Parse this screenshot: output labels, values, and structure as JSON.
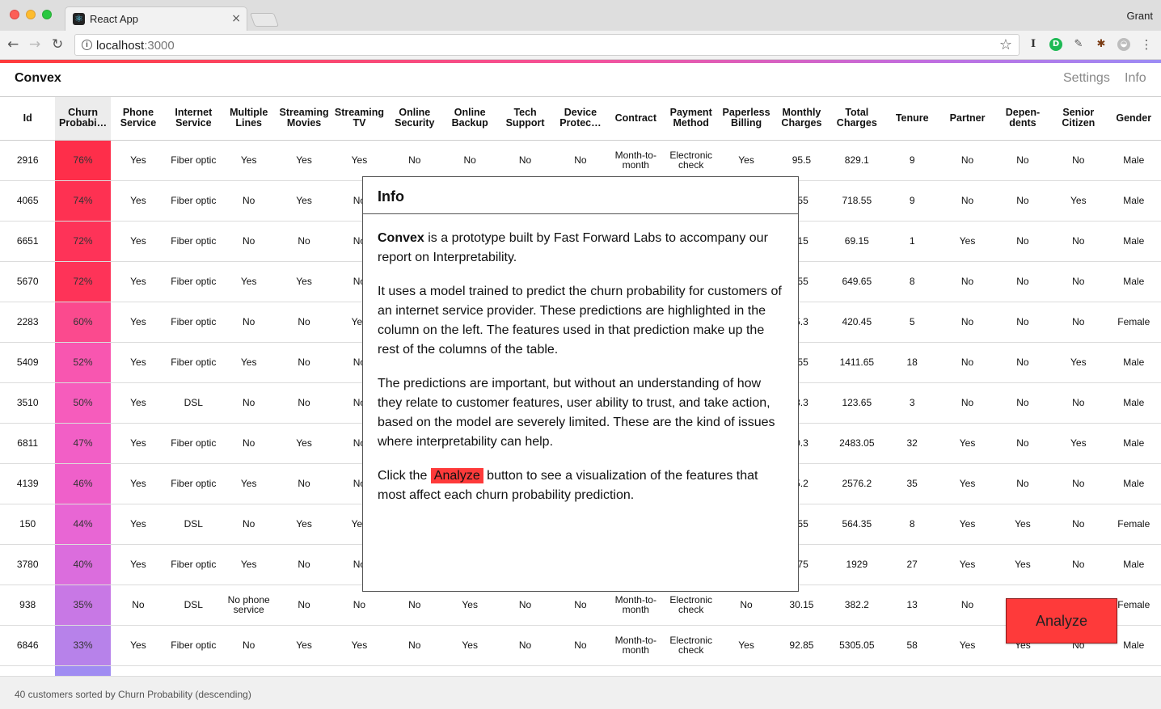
{
  "browser": {
    "tab_title": "React App",
    "url_host": "localhost",
    "url_port": ":3000",
    "profile_name": "Grant"
  },
  "app": {
    "title": "Convex",
    "nav": {
      "settings": "Settings",
      "info": "Info"
    }
  },
  "table": {
    "columns": [
      "Id",
      "Churn Probabi…",
      "Phone Service",
      "Internet Service",
      "Multiple Lines",
      "Streaming Movies",
      "Streaming TV",
      "Online Security",
      "Online Backup",
      "Tech Support",
      "Device Protec…",
      "Contract",
      "Payment Method",
      "Paperless Billing",
      "Monthly Charges",
      "Total Charges",
      "Tenure",
      "Partner",
      "Depen-dents",
      "Senior Citizen",
      "Gender"
    ],
    "rows": [
      [
        "2916",
        "76%",
        "Yes",
        "Fiber optic",
        "Yes",
        "Yes",
        "Yes",
        "No",
        "No",
        "No",
        "No",
        "Month-to-month",
        "Electronic check",
        "Yes",
        "95.5",
        "829.1",
        "9",
        "No",
        "No",
        "No",
        "Male"
      ],
      [
        "4065",
        "74%",
        "Yes",
        "Fiber optic",
        "No",
        "Yes",
        "No",
        "",
        "",
        "",
        "",
        "",
        "",
        "",
        ".55",
        "718.55",
        "9",
        "No",
        "No",
        "Yes",
        "Male"
      ],
      [
        "6651",
        "72%",
        "Yes",
        "Fiber optic",
        "No",
        "No",
        "No",
        "",
        "",
        "",
        "",
        "",
        "",
        "",
        ".15",
        "69.15",
        "1",
        "Yes",
        "No",
        "No",
        "Male"
      ],
      [
        "5670",
        "72%",
        "Yes",
        "Fiber optic",
        "Yes",
        "Yes",
        "No",
        "",
        "",
        "",
        "",
        "",
        "",
        "",
        ".55",
        "649.65",
        "8",
        "No",
        "No",
        "No",
        "Male"
      ],
      [
        "2283",
        "60%",
        "Yes",
        "Fiber optic",
        "No",
        "No",
        "Yes",
        "",
        "",
        "",
        "",
        "",
        "",
        "",
        "5.3",
        "420.45",
        "5",
        "No",
        "No",
        "No",
        "Female"
      ],
      [
        "5409",
        "52%",
        "Yes",
        "Fiber optic",
        "Yes",
        "No",
        "No",
        "",
        "",
        "",
        "",
        "",
        "",
        "",
        ".55",
        "1411.65",
        "18",
        "No",
        "No",
        "Yes",
        "Male"
      ],
      [
        "3510",
        "50%",
        "Yes",
        "DSL",
        "No",
        "No",
        "No",
        "",
        "",
        "",
        "",
        "",
        "",
        "",
        "3.3",
        "123.65",
        "3",
        "No",
        "No",
        "No",
        "Male"
      ],
      [
        "6811",
        "47%",
        "Yes",
        "Fiber optic",
        "No",
        "Yes",
        "No",
        "",
        "",
        "",
        "",
        "",
        "",
        "",
        "0.3",
        "2483.05",
        "32",
        "Yes",
        "No",
        "Yes",
        "Male"
      ],
      [
        "4139",
        "46%",
        "Yes",
        "Fiber optic",
        "Yes",
        "No",
        "No",
        "",
        "",
        "",
        "",
        "",
        "",
        "",
        "5.2",
        "2576.2",
        "35",
        "Yes",
        "No",
        "No",
        "Male"
      ],
      [
        "150",
        "44%",
        "Yes",
        "DSL",
        "No",
        "Yes",
        "Yes",
        "",
        "",
        "",
        "",
        "",
        "",
        "",
        ".55",
        "564.35",
        "8",
        "Yes",
        "Yes",
        "No",
        "Female"
      ],
      [
        "3780",
        "40%",
        "Yes",
        "Fiber optic",
        "Yes",
        "No",
        "No",
        "",
        "",
        "",
        "",
        "",
        "",
        "",
        ".75",
        "1929",
        "27",
        "Yes",
        "Yes",
        "No",
        "Male"
      ],
      [
        "938",
        "35%",
        "No",
        "DSL",
        "No phone service",
        "No",
        "No",
        "No",
        "Yes",
        "No",
        "No",
        "Month-to-month",
        "Electronic check",
        "No",
        "30.15",
        "382.2",
        "13",
        "No",
        "",
        "",
        "Female"
      ],
      [
        "6846",
        "33%",
        "Yes",
        "Fiber optic",
        "No",
        "Yes",
        "Yes",
        "No",
        "Yes",
        "No",
        "No",
        "Month-to-month",
        "Electronic check",
        "Yes",
        "92.85",
        "5305.05",
        "58",
        "Yes",
        "Yes",
        "No",
        "Male"
      ]
    ],
    "churn_colors": [
      "#fe2e4a",
      "#fe3152",
      "#fe3358",
      "#fe3358",
      "#fb4a8e",
      "#f856b0",
      "#f65cbc",
      "#f25fc6",
      "#ef60ca",
      "#e866d4",
      "#db6ddd",
      "#c878e5",
      "#b782ea"
    ],
    "last_partial_color": "#a08cf2"
  },
  "footer": {
    "status": "40 customers sorted by Churn Probability (descending)"
  },
  "analyze_button": {
    "label": "Analyze",
    "color": "#fe3a3a"
  },
  "modal": {
    "title": "Info",
    "p1_bold": "Convex",
    "p1_rest": " is a prototype built by Fast Forward Labs to accompany our report on Interpretability.",
    "p2": "It uses a model trained to predict the churn probability for customers of an internet service provider. These predictions are highlighted in the column on the left. The features used in that prediction make up the rest of the columns of the table.",
    "p3": "The predictions are important, but without an understanding of how they relate to customer features, user ability to trust, and take action, based on the model are severely limited. These are the kind of issues where interpretability can help.",
    "p4_before": "Click the ",
    "p4_highlight": "Analyze",
    "p4_after": " button to see a visualization of the features that most affect each churn probability prediction."
  }
}
